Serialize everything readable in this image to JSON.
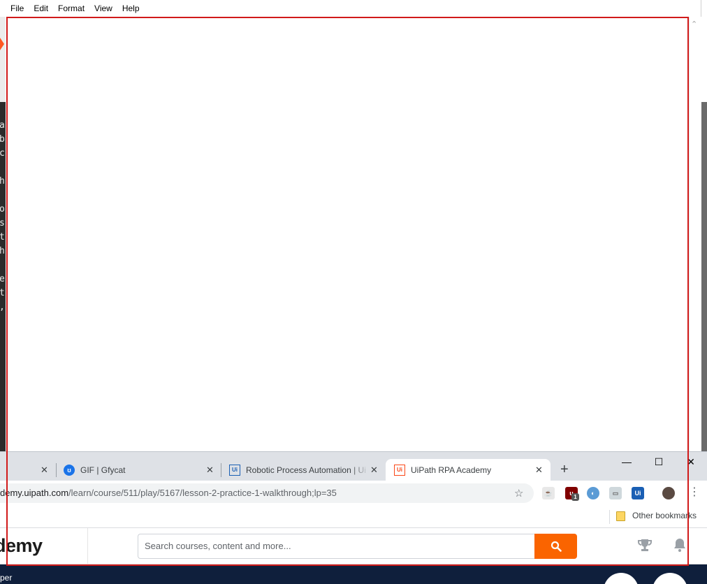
{
  "notepad": {
    "menu": [
      "File",
      "Edit",
      "Format",
      "View",
      "Help"
    ],
    "scroll_up_glyph": "⌃"
  },
  "background_code_chars": [
    "a",
    "b",
    "c",
    "h",
    "o",
    "s",
    "t",
    "h",
    "e",
    "t",
    ","
  ],
  "chrome": {
    "tabs": [
      {
        "title": "",
        "icon": "tab-icon"
      },
      {
        "title": "GIF | Gfycat",
        "icon": "gfycat-icon"
      },
      {
        "title": "Robotic Process Automation | Ui",
        "icon": "uipath-icon"
      },
      {
        "title": "UiPath RPA Academy",
        "icon": "uipath-icon",
        "active": true
      }
    ],
    "tab_close_glyph": "✕",
    "new_tab_glyph": "+",
    "window_buttons": {
      "minimize": "—",
      "maximize": "☐",
      "close": "✕"
    },
    "address": {
      "host": "demy.uipath.com",
      "path": "/learn/course/511/play/5167/lesson-2-practice-1-walkthrough;lp=35"
    },
    "bookmark_star_glyph": "☆",
    "extension_icons": [
      "coffee-icon",
      "ublock-icon",
      "edge-like-icon",
      "cast-icon",
      "uipath-ext-icon",
      "profile-avatar"
    ],
    "extension_badge": "1",
    "ui_ext_label": "Ui",
    "menu_glyph": "⋮",
    "other_bookmarks": "Other bookmarks"
  },
  "academy": {
    "brand": "demy",
    "search_placeholder": "Search courses, content and more...",
    "subnav_text": "per"
  },
  "colors": {
    "accent": "#fa6400",
    "selection": "#d11a1a",
    "navy": "#0f1f3c"
  }
}
